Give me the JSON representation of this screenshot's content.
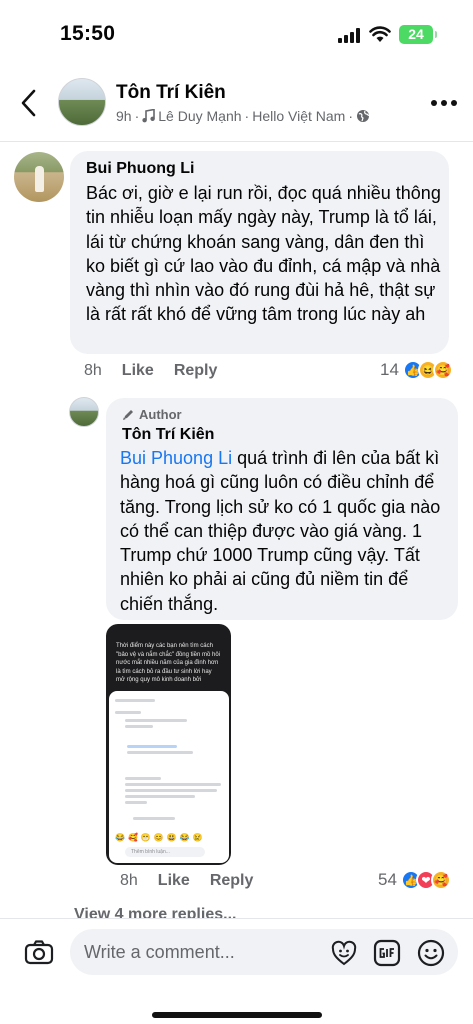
{
  "status_bar": {
    "time": "15:50",
    "battery": "24"
  },
  "header": {
    "title": "Tôn Trí Kiên",
    "time": "9h",
    "separator": "·",
    "music": "Lê Duy Mạnh",
    "location_sep": "·",
    "location": "Hello Việt Nam",
    "privacy_sep": "·"
  },
  "comments": [
    {
      "author": "Bui Phuong Li",
      "body": "Bác ơi, giờ e lại run rồi, đọc quá nhiều thông tin nhiễu loạn mấy ngày này, Trump là tổ lái, lái từ chứng khoán sang vàng, dân đen thì ko biết gì cứ lao vào đu đỉnh, cá mập và nhà vàng thì nhìn vào đó rung đùi hả hê, thật sự là rất rất khó để vững tâm trong lúc này ah",
      "time": "8h",
      "like_label": "Like",
      "reply_label": "Reply",
      "reaction_count": "14"
    }
  ],
  "reply": {
    "badge": "Author",
    "author": "Tôn Trí Kiên",
    "mention": "Bui Phuong Li",
    "body": " quá trình đi lên của bất kì hàng hoá gì cũng luôn có điều chỉnh để tăng. Trong lịch sử ko có 1 quốc gia nào có thể can thiệp được vào giá vàng. 1 Trump chứ 1000 Trump cũng vậy. Tất nhiên ko phải ai cũng đủ niềm tin để chiến thắng.",
    "attachment_text": "Thời điểm này các bạn nên tìm cách \"bảo vệ và nắm chắc\" đồng tiền mồ hôi nước mắt nhiều năm của gia đình hơn là tìm cách bỏ ra đầu tư sinh lời hay mở rộng quy mô kinh doanh bởi",
    "attachment_emojis": "😂🥰😁😊😃😂😢",
    "attachment_input": "Thêm bình luận...",
    "time": "8h",
    "like_label": "Like",
    "reply_label": "Reply",
    "reaction_count": "54"
  },
  "view_more": "View 4 more replies...",
  "composer": {
    "placeholder": "Write a comment..."
  }
}
